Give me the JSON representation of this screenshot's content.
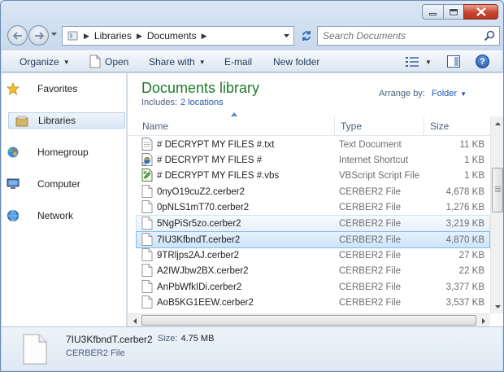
{
  "window": {
    "address": {
      "segments": [
        "Libraries",
        "Documents"
      ]
    },
    "search": {
      "placeholder": "Search Documents"
    }
  },
  "toolbar": {
    "organize": "Organize",
    "open": "Open",
    "share_with": "Share with",
    "email": "E-mail",
    "new_folder": "New folder"
  },
  "navigation": {
    "items": [
      {
        "label": "Favorites",
        "icon": "star-icon"
      },
      {
        "label": "Libraries",
        "icon": "libraries-icon",
        "selected": true
      },
      {
        "label": "Homegroup",
        "icon": "homegroup-icon"
      },
      {
        "label": "Computer",
        "icon": "computer-icon"
      },
      {
        "label": "Network",
        "icon": "network-icon"
      }
    ]
  },
  "library": {
    "title": "Documents library",
    "includes_label": "Includes:",
    "includes_link": "2 locations",
    "arrange_label": "Arrange by:",
    "arrange_value": "Folder"
  },
  "columns": {
    "name": "Name",
    "type": "Type",
    "size": "Size"
  },
  "files": [
    {
      "name": "# DECRYPT MY FILES #.txt",
      "type": "Text Document",
      "size": "11 KB",
      "icon": "text-document-icon"
    },
    {
      "name": "# DECRYPT MY FILES #",
      "type": "Internet Shortcut",
      "size": "1 KB",
      "icon": "internet-shortcut-icon"
    },
    {
      "name": "# DECRYPT MY FILES #.vbs",
      "type": "VBScript Script File",
      "size": "1 KB",
      "icon": "vbscript-icon"
    },
    {
      "name": "0nyO19cuZ2.cerber2",
      "type": "CERBER2 File",
      "size": "4,678 KB",
      "icon": "blank-file-icon"
    },
    {
      "name": "0pNLS1mT70.cerber2",
      "type": "CERBER2 File",
      "size": "1,276 KB",
      "icon": "blank-file-icon"
    },
    {
      "name": "5NgPiSr5zo.cerber2",
      "type": "CERBER2 File",
      "size": "3,219 KB",
      "icon": "blank-file-icon",
      "state": "hover"
    },
    {
      "name": "7IU3KfbndT.cerber2",
      "type": "CERBER2 File",
      "size": "4,870 KB",
      "icon": "blank-file-icon",
      "state": "selected"
    },
    {
      "name": "9TRljps2AJ.cerber2",
      "type": "CERBER2 File",
      "size": "27 KB",
      "icon": "blank-file-icon"
    },
    {
      "name": "A2IWJbw2BX.cerber2",
      "type": "CERBER2 File",
      "size": "22 KB",
      "icon": "blank-file-icon"
    },
    {
      "name": "AnPbWfkIDi.cerber2",
      "type": "CERBER2 File",
      "size": "3,377 KB",
      "icon": "blank-file-icon"
    },
    {
      "name": "AoB5KG1EEW.cerber2",
      "type": "CERBER2 File",
      "size": "3,537 KB",
      "icon": "blank-file-icon"
    }
  ],
  "details_pane": {
    "name": "7IU3KfbndT.cerber2",
    "size_label": "Size:",
    "size_value": "4.75 MB",
    "type": "CERBER2 File"
  },
  "colors": {
    "library_title": "#1e7a2a",
    "link": "#1d57b3",
    "selection": "#cde4fa"
  }
}
